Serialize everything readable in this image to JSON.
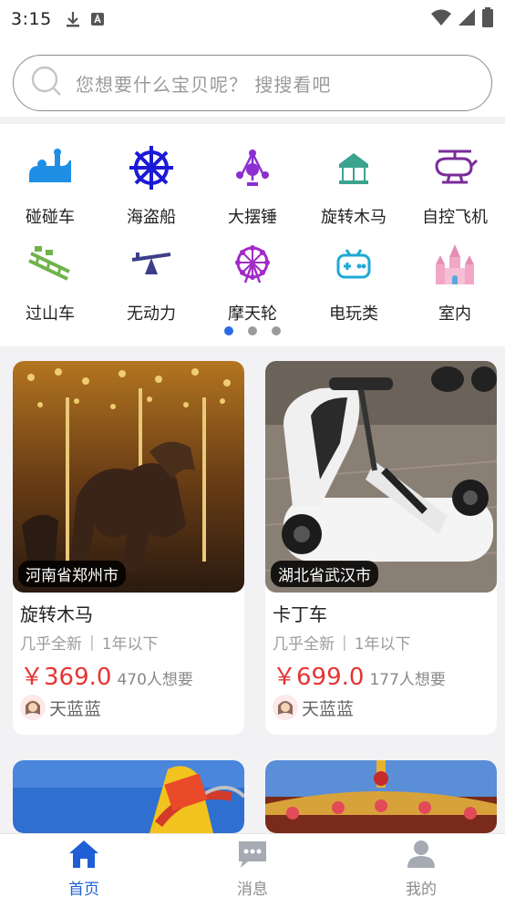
{
  "status_bar": {
    "time": "3:15"
  },
  "search": {
    "placeholder": "您想要什么宝贝呢？ 搜搜看吧"
  },
  "categories": [
    {
      "label": "碰碰车",
      "icon": "bumper-car-icon"
    },
    {
      "label": "海盗船",
      "icon": "ship-wheel-icon"
    },
    {
      "label": "大摆锤",
      "icon": "pendulum-ride-icon"
    },
    {
      "label": "旋转木马",
      "icon": "carousel-icon"
    },
    {
      "label": "自控飞机",
      "icon": "helicopter-icon"
    },
    {
      "label": "过山车",
      "icon": "roller-coaster-icon"
    },
    {
      "label": "无动力",
      "icon": "seesaw-icon"
    },
    {
      "label": "摩天轮",
      "icon": "ferris-wheel-icon"
    },
    {
      "label": "电玩类",
      "icon": "gamepad-icon"
    },
    {
      "label": "室内",
      "icon": "castle-icon"
    }
  ],
  "pager": {
    "pages": 3,
    "active": 1
  },
  "products": [
    {
      "location": "河南省郑州市",
      "title": "旋转木马",
      "condition": "几乎全新",
      "age": "1年以下",
      "price": "￥369.0",
      "wants": "470人想要",
      "seller": "天蓝蓝"
    },
    {
      "location": "湖北省武汉市",
      "title": "卡丁车",
      "condition": "几乎全新",
      "age": "1年以下",
      "price": "￥699.0",
      "wants": "177人想要",
      "seller": "天蓝蓝"
    }
  ],
  "bottom_nav": [
    {
      "label": "首页",
      "icon": "home-icon",
      "active": true
    },
    {
      "label": "消息",
      "icon": "message-icon",
      "active": false
    },
    {
      "label": "我的",
      "icon": "profile-icon",
      "active": false
    }
  ],
  "colors": {
    "accent": "#2b6be6",
    "price": "#e53434",
    "nav_active": "#1f5fd6"
  }
}
